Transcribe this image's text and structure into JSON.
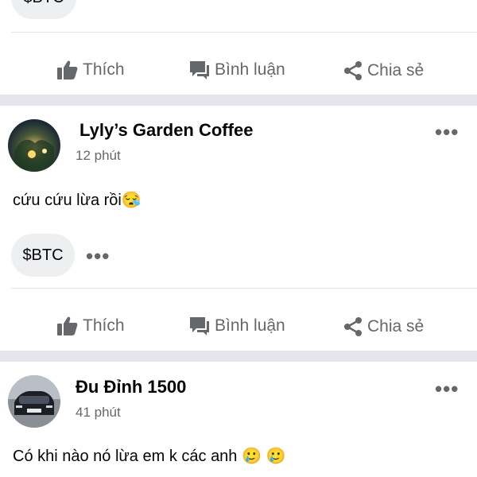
{
  "top": {
    "tag": "$BTC"
  },
  "actions": {
    "like": "Thích",
    "comment": "Bình luận",
    "share": "Chia sẻ"
  },
  "posts": [
    {
      "name": "Lyly’s Garden Coffee",
      "time": "12 phút",
      "text": "cứu cứu lừa rồi",
      "emoji": "😪",
      "tag": "$BTC",
      "more": "•••"
    },
    {
      "name": "Đu Đỉnh 1500",
      "time": "41 phút",
      "text": "Có khi nào nó lừa em k các anh",
      "emoji": "🥲 🥲",
      "more": "•••"
    }
  ],
  "icons": [
    "thumbs-up-icon",
    "comment-icon",
    "share-icon",
    "more-options-icon",
    "avatar"
  ]
}
